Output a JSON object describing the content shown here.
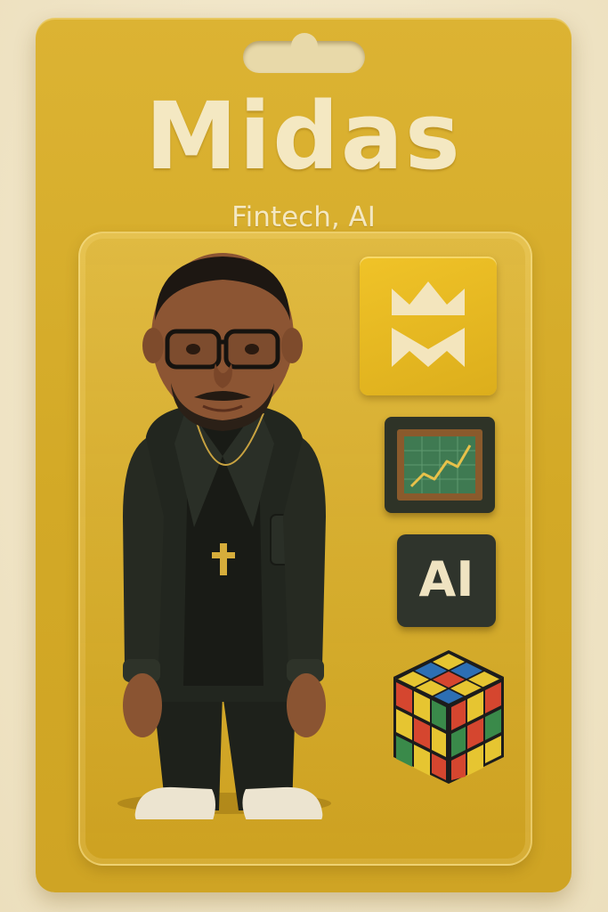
{
  "card": {
    "title": "Midas",
    "subtitle": "Fintech, AI"
  },
  "accessories": {
    "ai_badge_label": "AI"
  },
  "colors": {
    "card_yellow": "#d6ab2a",
    "cream_text": "#f4e8c2",
    "tile_dark": "#2f342c",
    "chart_green": "#3f7a52",
    "chart_line": "#e7c14a"
  },
  "icons": [
    "crown-logo-icon",
    "chart-icon",
    "ai-icon",
    "rubiks-cube-icon"
  ]
}
